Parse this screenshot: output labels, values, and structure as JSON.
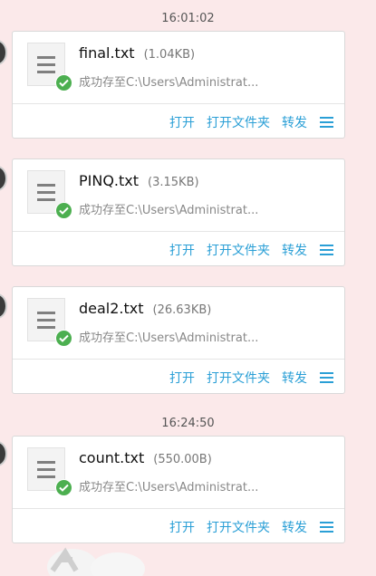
{
  "timestamps": [
    "16:01:02",
    "16:24:50"
  ],
  "messages": [
    {
      "name": "final.txt",
      "size": "(1.04KB)",
      "status": "成功存至C:\\Users\\Administrat..."
    },
    {
      "name": "PINQ.txt",
      "size": "(3.15KB)",
      "status": "成功存至C:\\Users\\Administrat..."
    },
    {
      "name": "deal2.txt",
      "size": "(26.63KB)",
      "status": "成功存至C:\\Users\\Administrat..."
    },
    {
      "name": "count.txt",
      "size": "(550.00B)",
      "status": "成功存至C:\\Users\\Administrat..."
    }
  ],
  "actions": {
    "open": "打开",
    "open_folder": "打开文件夹",
    "forward": "转发"
  },
  "icons": {
    "file": "file-doc-icon",
    "check": "check-circle-icon",
    "menu": "menu-icon"
  },
  "colors": {
    "link": "#2a9fd6",
    "success": "#4caf50",
    "background": "#fbe9ea"
  }
}
